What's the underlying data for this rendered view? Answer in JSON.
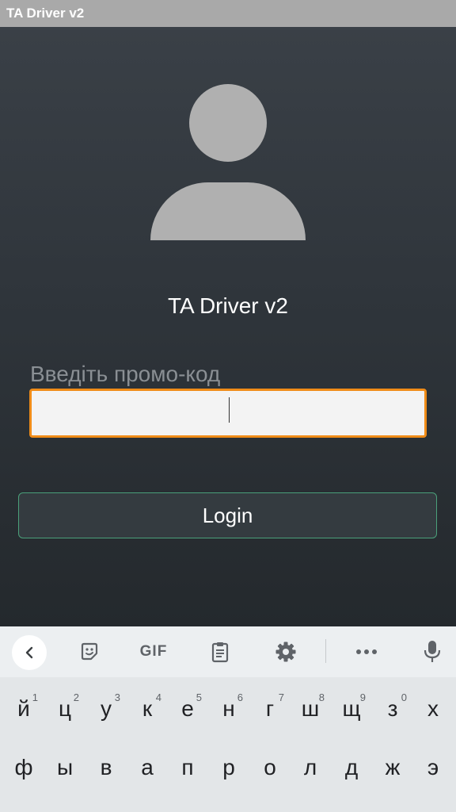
{
  "window": {
    "title": "TA Driver v2"
  },
  "app": {
    "name": "TA Driver v2",
    "promo_label": "Введіть промо-код",
    "promo_value": "",
    "login_label": "Login"
  },
  "keyboard": {
    "toolbar": {
      "items": [
        "back-icon",
        "sticker-icon",
        "GIF",
        "clipboard-icon",
        "gear-icon",
        "more-icon",
        "microphone-icon"
      ],
      "gif_label": "GIF"
    },
    "row1": [
      {
        "label": "й",
        "hint": "1"
      },
      {
        "label": "ц",
        "hint": "2"
      },
      {
        "label": "у",
        "hint": "3"
      },
      {
        "label": "к",
        "hint": "4"
      },
      {
        "label": "е",
        "hint": "5"
      },
      {
        "label": "н",
        "hint": "6"
      },
      {
        "label": "г",
        "hint": "7"
      },
      {
        "label": "ш",
        "hint": "8"
      },
      {
        "label": "щ",
        "hint": "9"
      },
      {
        "label": "з",
        "hint": "0"
      },
      {
        "label": "х",
        "hint": ""
      }
    ],
    "row2": [
      {
        "label": "ф"
      },
      {
        "label": "ы"
      },
      {
        "label": "в"
      },
      {
        "label": "а"
      },
      {
        "label": "п"
      },
      {
        "label": "р"
      },
      {
        "label": "о"
      },
      {
        "label": "л"
      },
      {
        "label": "д"
      },
      {
        "label": "ж"
      },
      {
        "label": "э"
      }
    ]
  },
  "colors": {
    "accent_border": "#f08c18",
    "login_border": "#4aa07a",
    "avatar": "#b0b0b0"
  }
}
